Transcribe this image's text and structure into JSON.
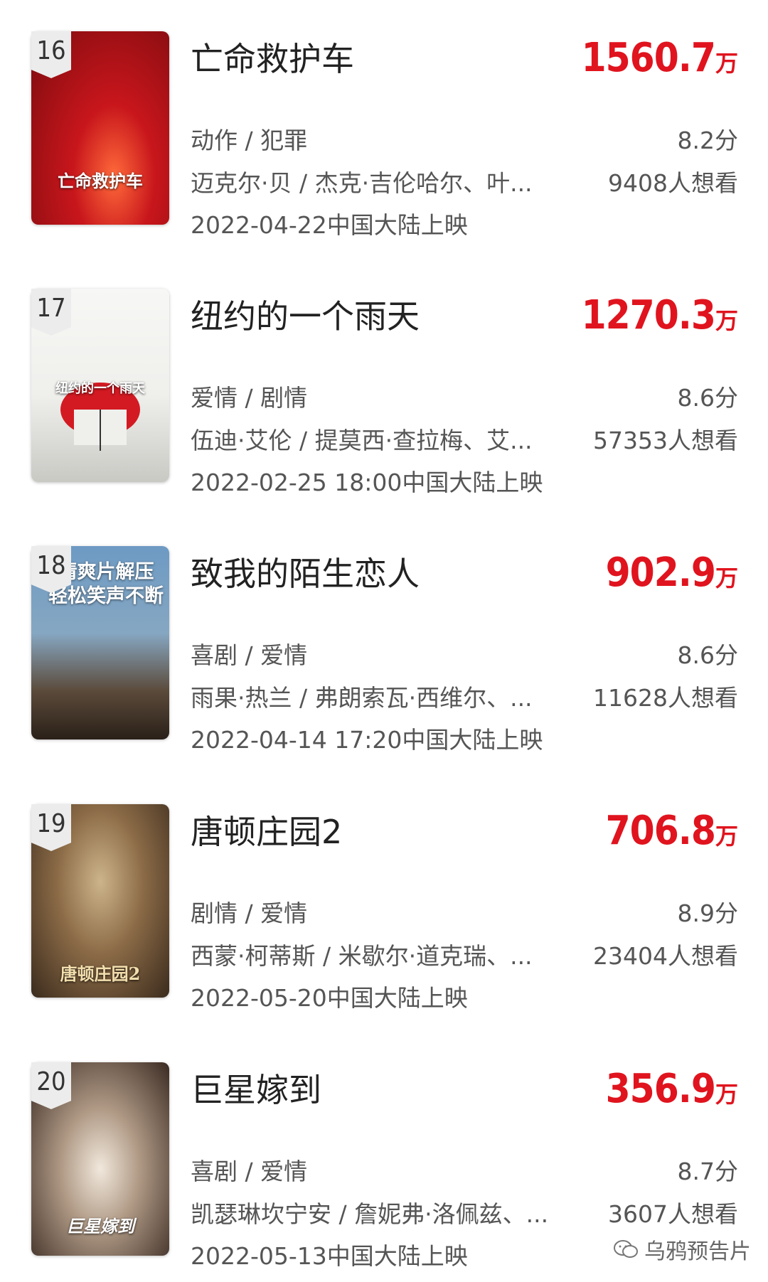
{
  "colors": {
    "accent": "#e0141e",
    "rank_badge_bg": "#ececec"
  },
  "movies": [
    {
      "rank": "16",
      "title": "亡命救护车",
      "box_value": "1560.7",
      "box_unit": "万",
      "genre": "动作 / 犯罪",
      "rating": "8.2分",
      "cast": "迈克尔·贝 / 杰克·吉伦哈尔、叶...",
      "wants": "9408人想看",
      "release": "2022-04-22中国大陆上映",
      "poster_text": "亡命救护车"
    },
    {
      "rank": "17",
      "title": "纽约的一个雨天",
      "box_value": "1270.3",
      "box_unit": "万",
      "genre": "爱情 / 剧情",
      "rating": "8.6分",
      "cast": "伍迪·艾伦 / 提莫西·查拉梅、艾...",
      "wants": "57353人想看",
      "release": "2022-02-25 18:00中国大陆上映",
      "poster_text": "纽约的一个雨天"
    },
    {
      "rank": "18",
      "title": "致我的陌生恋人",
      "box_value": "902.9",
      "box_unit": "万",
      "genre": "喜剧 / 爱情",
      "rating": "8.6分",
      "cast": "雨果·热兰 / 弗朗索瓦·西维尔、...",
      "wants": "11628人想看",
      "release": "2022-04-14 17:20中国大陆上映",
      "poster_text": "情爽片解压 轻松笑声不断"
    },
    {
      "rank": "19",
      "title": "唐顿庄园2",
      "box_value": "706.8",
      "box_unit": "万",
      "genre": "剧情 / 爱情",
      "rating": "8.9分",
      "cast": "西蒙·柯蒂斯 / 米歇尔·道克瑞、...",
      "wants": "23404人想看",
      "release": "2022-05-20中国大陆上映",
      "poster_text": "唐顿庄园2"
    },
    {
      "rank": "20",
      "title": "巨星嫁到",
      "box_value": "356.9",
      "box_unit": "万",
      "genre": "喜剧 / 爱情",
      "rating": "8.7分",
      "cast": "凯瑟琳坎宁安 / 詹妮弗·洛佩兹、...",
      "wants": "3607人想看",
      "release": "2022-05-13中国大陆上映",
      "poster_text": "巨星嫁到"
    }
  ],
  "watermark": {
    "text": "乌鸦预告片",
    "icon": "wechat-icon"
  }
}
